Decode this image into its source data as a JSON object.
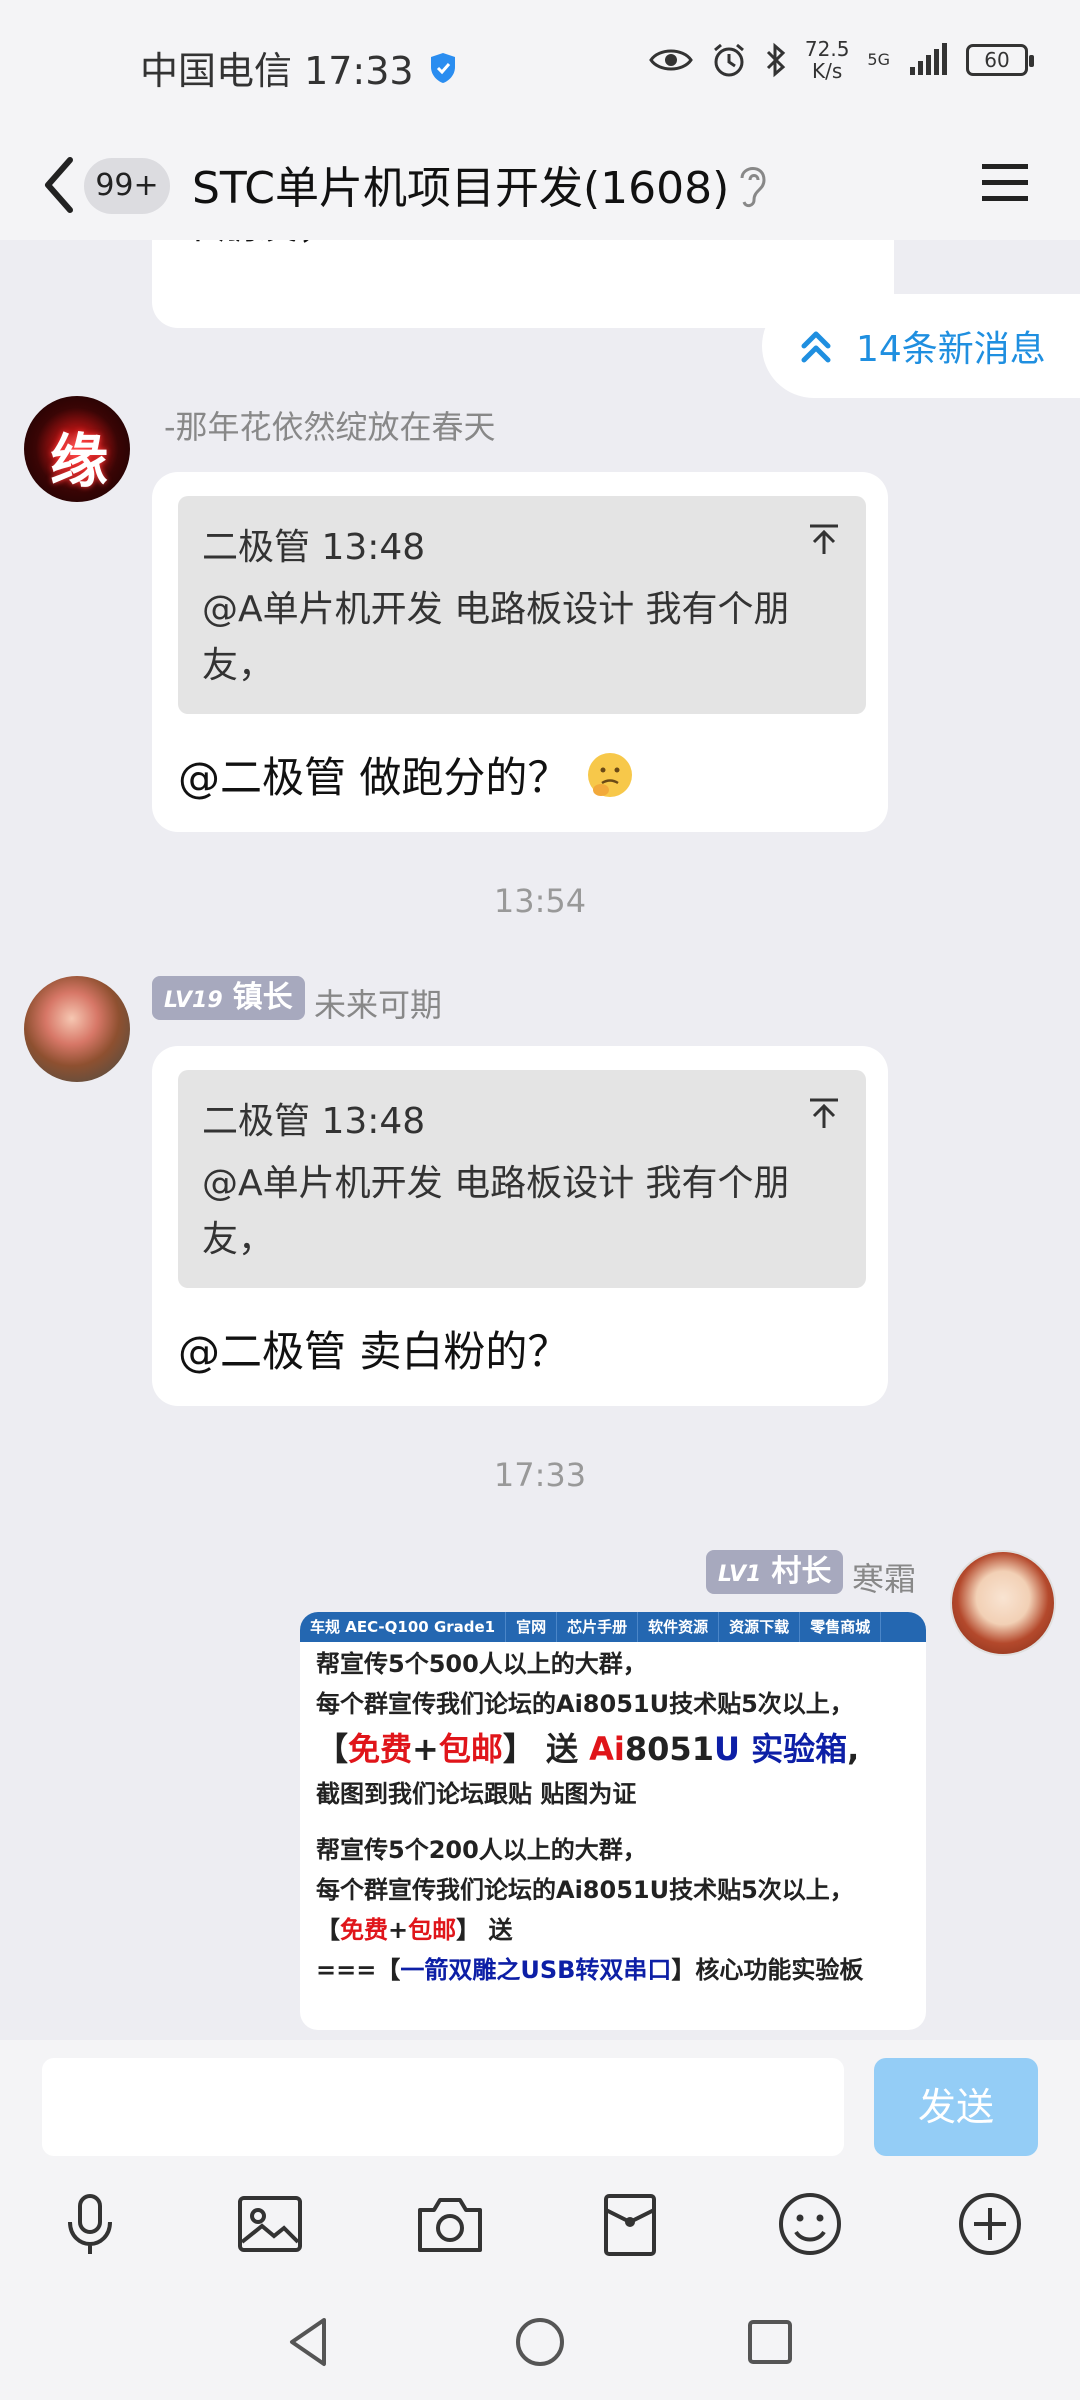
{
  "status_bar": {
    "carrier_time": "中国电信 17:33",
    "speed_value": "72.5",
    "speed_unit": "K/s",
    "network": "5G",
    "battery": "60"
  },
  "header": {
    "unread_badge": "99+",
    "title": "STC单片机项目开发(1608)"
  },
  "new_messages": {
    "label": "14条新消息"
  },
  "messages": [
    {
      "partial_text": "个朋友，"
    },
    {
      "sender": "-那年花依然绽放在春天",
      "quote_author_time": "二极管 13:48",
      "quote_text": "@A单片机开发 电路板设计 我有个朋友，",
      "text": "@二极管 做跑分的？"
    },
    {
      "time": "13:54"
    },
    {
      "level": "LV19",
      "title": "镇长",
      "sender": "未来可期",
      "quote_author_time": "二极管 13:48",
      "quote_text": "@A单片机开发 电路板设计 我有个朋友，",
      "text": "@二极管 卖白粉的？"
    },
    {
      "time": "17:33"
    },
    {
      "level": "LV1",
      "title": "村长",
      "sender": "寒霜",
      "image": {
        "nav": [
          "车规 AEC-Q100 Grade1",
          "官网",
          "芯片手册",
          "软件资源",
          "资源下载",
          "零售商城"
        ],
        "line1": "帮宣传5个500人以上的大群，",
        "line2": "每个群宣传我们论坛的Ai8051U技术贴5次以上，",
        "line3_a": "【",
        "line3_free": "免费",
        "line3_plus": "+",
        "line3_ship": "包邮",
        "line3_b": "】 送 ",
        "line3_ai": "Ai",
        "line3_8051": "8051",
        "line3_u": "U 实验箱",
        "line3_c": ",",
        "line4": "截图到我们论坛跟贴 贴图为证",
        "line5": "帮宣传5个200人以上的大群，",
        "line6": "每个群宣传我们论坛的Ai8051U技术贴5次以上，",
        "line7_a": "【",
        "line7_free": "免费",
        "line7_plus": "+",
        "line7_ship": "包邮",
        "line7_b": "】 送",
        "line8_a": "===【",
        "line8_b": "一箭双雕之USB转双串口",
        "line8_c": "】核心功能实验板"
      }
    }
  ],
  "input": {
    "send_label": "发送"
  },
  "toolbar_icons": [
    "microphone-icon",
    "image-icon",
    "camera-icon",
    "red-packet-icon",
    "emoji-icon",
    "plus-icon"
  ],
  "nav_icons": [
    "back-triangle-icon",
    "home-circle-icon",
    "recent-square-icon"
  ]
}
